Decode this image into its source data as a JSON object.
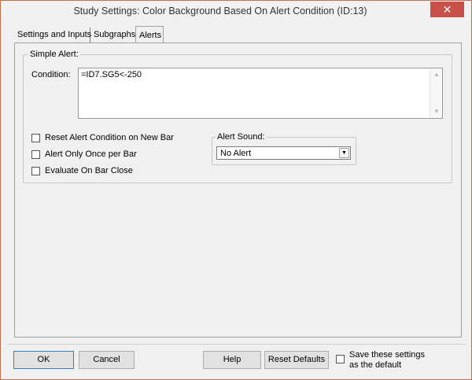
{
  "window": {
    "title": "Study Settings: Color Background Based On Alert Condition (ID:13)",
    "close_label": "✕"
  },
  "tabs": [
    {
      "label": "Settings and Inputs"
    },
    {
      "label": "Subgraphs"
    },
    {
      "label": "Alerts",
      "active": true
    }
  ],
  "alerts": {
    "simple_alert_label": "Simple Alert:",
    "condition_label": "Condition:",
    "condition_value": "=ID7.SG5<-250",
    "checkboxes": [
      {
        "label": "Reset Alert Condition on New Bar",
        "checked": false
      },
      {
        "label": "Alert Only Once per Bar",
        "checked": false
      },
      {
        "label": "Evaluate On Bar Close",
        "checked": false
      }
    ],
    "alert_sound_label": "Alert Sound:",
    "alert_sound_value": "No Alert"
  },
  "buttons": {
    "ok": "OK",
    "cancel": "Cancel",
    "help": "Help",
    "reset_defaults": "Reset Defaults"
  },
  "save_default": {
    "label_line1": "Save these settings",
    "label_line2": "as the default",
    "checked": false
  },
  "colors": {
    "close_button": "#c7504a",
    "window_border": "#c56f4a",
    "dialog_bg": "#f0f0f0"
  }
}
